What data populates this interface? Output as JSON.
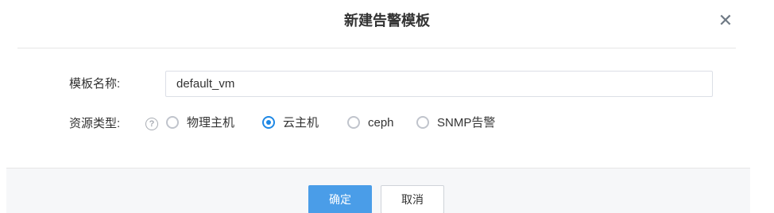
{
  "dialog": {
    "title": "新建告警模板",
    "close_icon": "close-icon"
  },
  "form": {
    "template_name": {
      "label": "模板名称:",
      "value": "default_vm"
    },
    "resource_type": {
      "label": "资源类型:",
      "help_icon": "question-circle-icon",
      "help_glyph": "?",
      "selected": "云主机",
      "options": [
        {
          "label": "物理主机",
          "checked": false
        },
        {
          "label": "云主机",
          "checked": true
        },
        {
          "label": "ceph",
          "checked": false
        },
        {
          "label": "SNMP告警",
          "checked": false
        }
      ]
    }
  },
  "footer": {
    "confirm_label": "确定",
    "cancel_label": "取消"
  },
  "colors": {
    "primary": "#4a9de8",
    "radio_checked": "#1e88e5",
    "footer_bg": "#f6f7f9"
  }
}
